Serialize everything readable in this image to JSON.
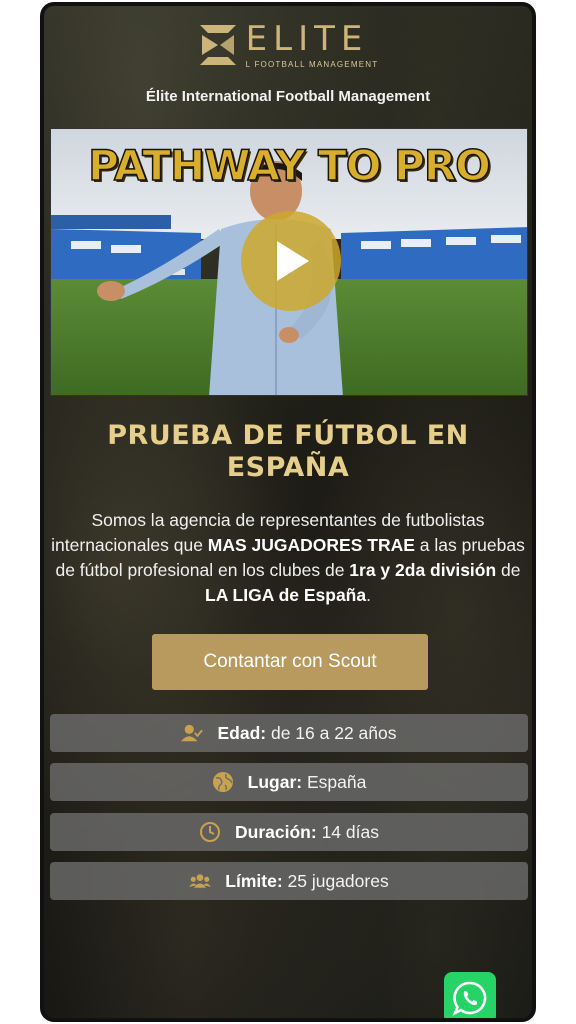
{
  "logo": {
    "word": "ELITE",
    "sub": "L FOOTBALL MANAGEMENT"
  },
  "brand_line": "Élite International Football Management",
  "video": {
    "title": "PATHWAY TO PRO",
    "play_icon": "play-icon"
  },
  "headline": "PRUEBA DE FÚTBOL EN ESPAÑA",
  "description": {
    "p1": "Somos la agencia de representantes de futbolistas internacionales que ",
    "b1": "MAS JUGADORES TRAE",
    "p2": " a las pruebas de fútbol profesional en los clubes de ",
    "b2": "1ra y 2da división",
    "p3": " de ",
    "b3": "LA LIGA de España",
    "p4": "."
  },
  "cta_label": "Contantar con Scout",
  "info": [
    {
      "icon": "user-check-icon",
      "label": "Edad:",
      "value": " de 16 a 22 años"
    },
    {
      "icon": "globe-icon",
      "label": "Lugar:",
      "value": " España"
    },
    {
      "icon": "clock-icon",
      "label": "Duración:",
      "value": " 14 días"
    },
    {
      "icon": "users-icon",
      "label": "Límite:",
      "value": " 25 jugadores"
    }
  ],
  "whatsapp_icon": "whatsapp-icon",
  "colors": {
    "gold": "#c8a84b",
    "button": "#b89a5e",
    "whatsapp": "#25d366"
  }
}
